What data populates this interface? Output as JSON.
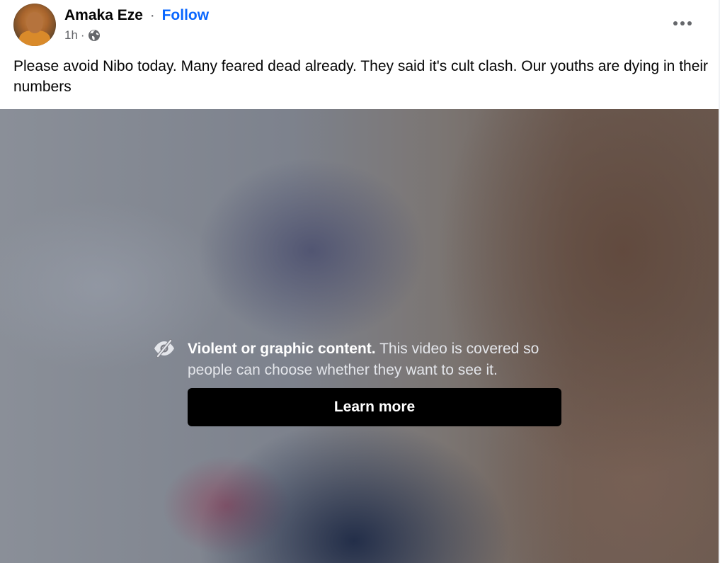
{
  "post": {
    "author": "Amaka Eze",
    "separator": "·",
    "follow_label": "Follow",
    "timestamp": "1h",
    "meta_separator": "·",
    "audience_icon": "globe-icon",
    "more_icon": "more-options-icon",
    "text": "Please avoid Nibo today. Many feared dead already. They said it's cult clash. Our youths are dying in their numbers"
  },
  "video": {
    "warning_icon": "hidden-eye-icon",
    "warning_title": "Violent or graphic content.",
    "warning_body": " This video is covered so people can choose whether they want to see it.",
    "learn_more_label": "Learn more"
  },
  "colors": {
    "follow_link": "#0866ff",
    "meta_text": "#65676b",
    "button_bg": "#000000"
  }
}
